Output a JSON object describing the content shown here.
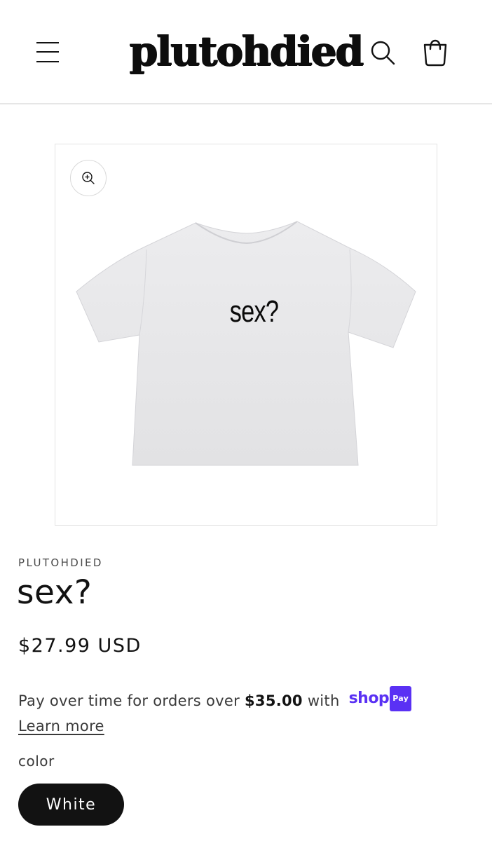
{
  "header": {
    "logo_text": "plutohdied",
    "menu_icon": "hamburger-menu-icon",
    "search_icon": "search-icon",
    "cart_icon": "cart-bag-icon"
  },
  "product": {
    "image_text": "sex?",
    "zoom_icon": "zoom-in-icon",
    "vendor": "PLUTOHDIED",
    "title": "sex?",
    "price": "$27.99 USD"
  },
  "installments": {
    "text_before": "Pay over time for orders over ",
    "threshold": "$35.00",
    "text_after": " with ",
    "shop_word": "shop",
    "pay_badge": "Pay",
    "learn_more": "Learn more",
    "brand_color": "#5a31f4"
  },
  "variant": {
    "label": "color",
    "selected": "White"
  }
}
